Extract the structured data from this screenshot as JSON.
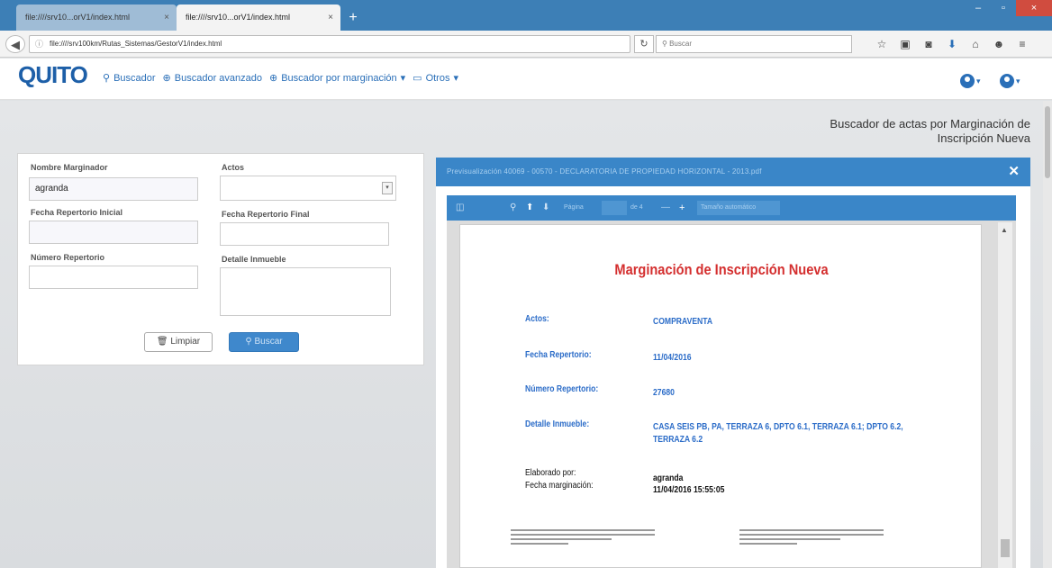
{
  "browser": {
    "tabs": [
      {
        "label": "file:////srv10...orV1/index.html"
      },
      {
        "label": "file:////srv10...orV1/index.html"
      }
    ],
    "url": "file:////srv100km/Rutas_Sistemas/GestorV1/index.html",
    "search_placeholder": "Buscar"
  },
  "header": {
    "logo": "QUITO",
    "menu": [
      {
        "label": "Buscador"
      },
      {
        "label": "Buscador avanzado"
      },
      {
        "label": "Buscador por marginación"
      },
      {
        "label": "Otros"
      }
    ]
  },
  "page": {
    "title_line1": "Buscador de actas por Marginación de",
    "title_line2": "Inscripción Nueva"
  },
  "form": {
    "nombre_label": "Nombre Marginador",
    "nombre_value": "agranda",
    "actos_label": "Actos",
    "fecha_inicial_label": "Fecha Repertorio Inicial",
    "fecha_final_label": "Fecha Repertorio Final",
    "numero_label": "Número Repertorio",
    "detalle_label": "Detalle Inmueble",
    "clear_label": "Limpiar",
    "search_label": "Buscar"
  },
  "preview": {
    "title": "Previsualización 40069 - 00570 - DECLARATORIA DE PROPIEDAD HORIZONTAL - 2013.pdf",
    "toolbar": {
      "page_label": "Página",
      "page_count": "de 4",
      "zoom": "Tamaño automático"
    },
    "doc_title": "Marginación de Inscripción Nueva",
    "rows": [
      {
        "label": "Actos:",
        "value": "COMPRAVENTA"
      },
      {
        "label": "Fecha Repertorio:",
        "value": "11/04/2016"
      },
      {
        "label": "Número Repertorio:",
        "value": "27680"
      },
      {
        "label": "Detalle Inmueble:",
        "value": "CASA SEIS PB, PA, TERRAZA 6, DPTO 6.1, TERRAZA 6.1; DPTO 6.2, TERRAZA 6.2"
      }
    ],
    "elaborado_label": "Elaborado por:",
    "elaborado_value": "agranda",
    "fecha_marg_label": "Fecha marginación:",
    "fecha_marg_value": "11/04/2016 15:55:05"
  }
}
